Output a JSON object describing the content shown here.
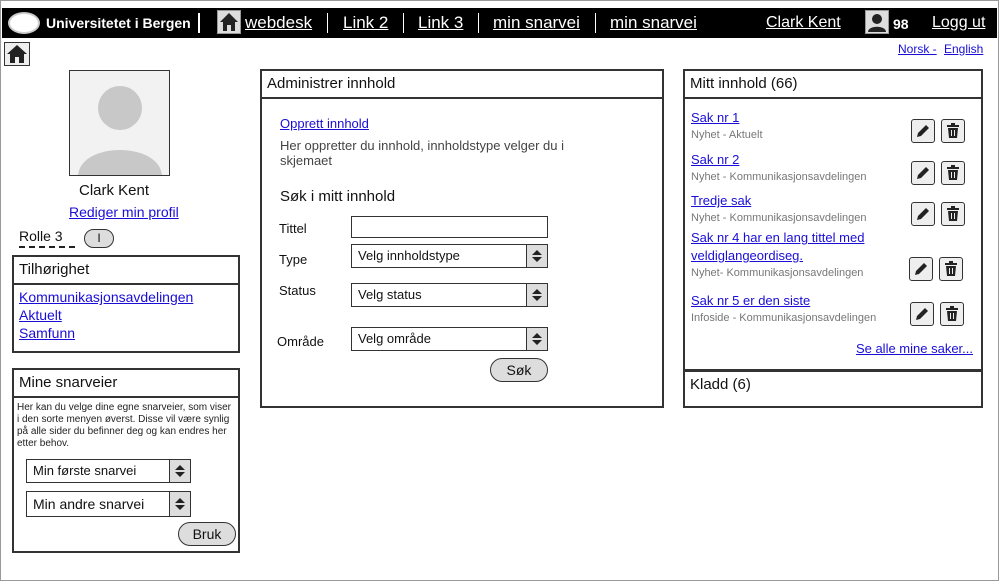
{
  "topbar": {
    "university": "Universitetet i Bergen",
    "home_label": "webdesk",
    "links": [
      "Link 2",
      "Link 3",
      "min snarvei",
      "min snarvei"
    ],
    "user": "Clark Kent",
    "count": "98",
    "logout": "Logg ut"
  },
  "lang": {
    "norsk": "Norsk -",
    "english": "English"
  },
  "profile": {
    "name": "Clark Kent",
    "edit_link": "Rediger min profil",
    "role": "Rolle 3",
    "role_toggle": "I"
  },
  "tilhorighet": {
    "title": "Tilhørighet",
    "items": [
      "Kommunikasjonsavdelingen",
      "Aktuelt",
      "Samfunn"
    ]
  },
  "snarveier": {
    "title": "Mine snarveier",
    "desc": "Her kan du velge dine egne snarveier, som viser i den sorte menyen øverst. Disse vil være synlig på alle sider du befinner deg og kan endres her etter behov.",
    "select1": "Min første snarvei",
    "select2": "Min andre snarvei",
    "button": "Bruk"
  },
  "administrer": {
    "title": "Administrer innhold",
    "create_link": "Opprett innhold",
    "create_desc": "Her oppretter du innhold, innholdstype velger du i skjemaet",
    "search_title": "Søk i mitt innhold",
    "label_title": "Tittel",
    "title_value": "",
    "label_type": "Type",
    "type_value": "Velg innholdstype",
    "label_status": "Status",
    "status_value": "Velg status",
    "label_area": "Område",
    "area_value": "Velg område",
    "search_button": "Søk"
  },
  "mitt_innhold": {
    "title": "Mitt innhold (66)",
    "items": [
      {
        "title": "Sak nr 1",
        "sub": "Nyhet - Aktuelt"
      },
      {
        "title": "Sak nr 2",
        "sub": "Nyhet - Kommunikasjonsavdelingen"
      },
      {
        "title": "Tredje sak",
        "sub": "Nyhet - Kommunikasjonsavdelingen"
      },
      {
        "title": "Sak nr 4 har en lang tittel med veldiglangeordiseg.",
        "sub": "Nyhet- Kommunikasjonsavdelingen"
      },
      {
        "title": "Sak nr 5 er den siste",
        "sub": "Infoside - Kommunikasjonsavdelingen"
      }
    ],
    "see_all": "Se alle mine saker..."
  },
  "kladd": {
    "title": "Kladd (6)"
  }
}
